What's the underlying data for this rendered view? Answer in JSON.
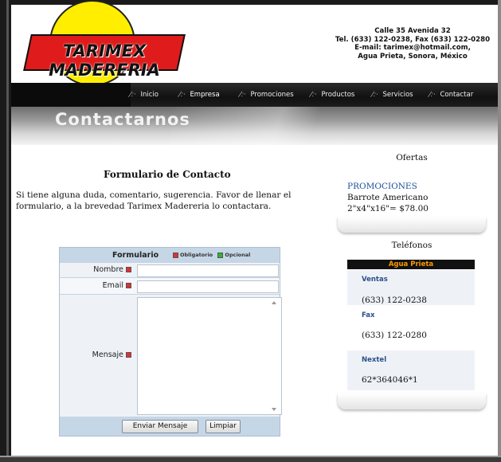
{
  "header": {
    "logo_text": "TARIMEX MADERERIA",
    "contact_lines": [
      "Calle 35 Avenida 32",
      "Tel. (633) 122-0238, Fax (633) 122-0280",
      "E-mail: tarimex@hotmail.com,",
      "Agua Prieta, Sonora, México"
    ]
  },
  "nav": {
    "items": [
      "Inicio",
      "Empresa",
      "Promociones",
      "Productos",
      "Servicios",
      "Contactar"
    ]
  },
  "banner": {
    "title": "Contactarnos"
  },
  "main": {
    "heading": "Formulario de Contacto",
    "intro": "Si tiene alguna duda, comentario, sugerencia. Favor de llenar el formulario, a la brevedad Tarimex Madereria lo contactara."
  },
  "form": {
    "title": "Formulario",
    "legend_required": "Obligatorio",
    "legend_optional": "Opcional",
    "fields": {
      "name_label": "Nombre",
      "email_label": "Email",
      "message_label": "Mensaje"
    },
    "values": {
      "name": "",
      "email": "",
      "message": ""
    },
    "submit_label": "Enviar Mensaje",
    "reset_label": "Limpiar"
  },
  "sidebar": {
    "offers_title": "Ofertas",
    "promo_title": "PROMOCIONES",
    "promo_lines": [
      "Barrote Americano",
      "2\"x4\"x16\"= $78.00"
    ],
    "phones_title": "Teléfonos",
    "location": "Agua Prieta",
    "contacts": [
      {
        "label": "Ventas",
        "value": "(633) 122-0238"
      },
      {
        "label": "Fax",
        "value": "(633) 122-0280"
      },
      {
        "label": "Nextel",
        "value": "62*364046*1"
      }
    ]
  },
  "colors": {
    "logo_red": "#e01b1b",
    "logo_yellow": "#ffee00",
    "nav_bg": "#111111",
    "link_blue": "#1f4e99",
    "accent_orange": "#ff9900",
    "form_bg": "#c5d6e6"
  }
}
